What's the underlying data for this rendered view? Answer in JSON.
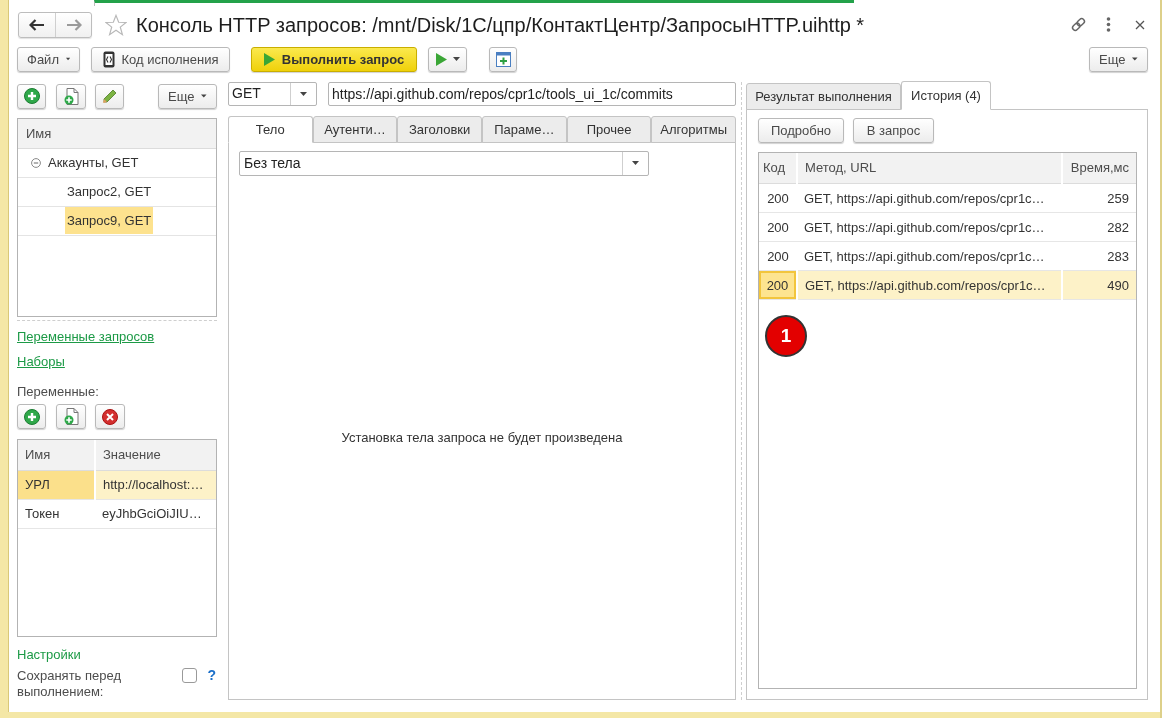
{
  "window": {
    "title": "Консоль HTTP запросов: /mnt/Disk/1C/цпр/КонтактЦентр/ЗапросыHTTP.uihttp *"
  },
  "toolbar": {
    "file_menu": "Файл",
    "code_button": "Код исполнения",
    "run_button": "Выполнить запрос",
    "more_button": "Еще"
  },
  "requests_panel": {
    "more_button": "Еще",
    "tree": {
      "column": "Имя",
      "items": [
        {
          "label": "Аккаунты, GET",
          "expanded": true,
          "selected": false,
          "children": [
            {
              "label": "Запрос2, GET",
              "selected": false
            },
            {
              "label": "Запрос9, GET",
              "selected": true
            }
          ]
        }
      ]
    },
    "links": [
      "Переменные запросов",
      "Наборы"
    ],
    "variables_label": "Переменные:",
    "variables": {
      "columns": [
        "Имя",
        "Значение"
      ],
      "rows": [
        {
          "name": "УРЛ",
          "value": "http://localhost:…",
          "selected": true
        },
        {
          "name": "Токен",
          "value": "eyJhbGciOiJIU…",
          "selected": false
        }
      ]
    },
    "settings": {
      "heading": "Настройки",
      "option": {
        "label": "Сохранять перед выполнением:",
        "checked": false,
        "help": "?"
      }
    }
  },
  "request": {
    "method": "GET",
    "url": "https://api.github.com/repos/cpr1c/tools_ui_1c/commits",
    "tabs": [
      {
        "label": "Тело",
        "selected": true
      },
      {
        "label": "Аутенти…",
        "selected": false
      },
      {
        "label": "Заголовки",
        "selected": false
      },
      {
        "label": "Параме…",
        "selected": false
      },
      {
        "label": "Прочее",
        "selected": false
      },
      {
        "label": "Алгоритмы",
        "selected": false
      }
    ],
    "body_type": "Без тела",
    "body_message": "Установка тела запроса не будет произведена"
  },
  "result_panel": {
    "tabs": [
      {
        "label": "Результат выполнения",
        "selected": false
      },
      {
        "label": "История (4)",
        "selected": true
      }
    ],
    "buttons": [
      "Подробно",
      "В запрос"
    ],
    "history": {
      "columns": [
        "Код",
        "Метод, URL",
        "Время,мс"
      ],
      "rows": [
        {
          "code": "200",
          "request": "GET, https://api.github.com/repos/cpr1c…",
          "time": "259",
          "selected": false
        },
        {
          "code": "200",
          "request": "GET, https://api.github.com/repos/cpr1c…",
          "time": "282",
          "selected": false
        },
        {
          "code": "200",
          "request": "GET, https://api.github.com/repos/cpr1c…",
          "time": "283",
          "selected": false
        },
        {
          "code": "200",
          "request": "GET, https://api.github.com/repos/cpr1c…",
          "time": "490",
          "selected": true
        }
      ]
    },
    "marker": "1"
  }
}
